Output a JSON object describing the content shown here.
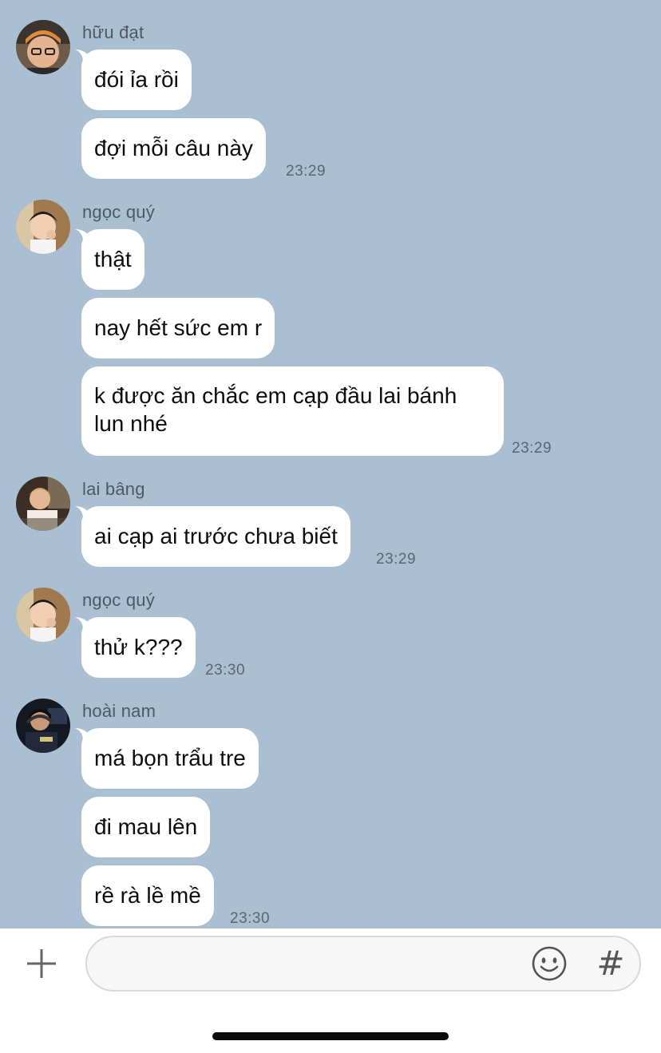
{
  "messages": [
    {
      "sender": "hữu đạt",
      "avatar": "avatar-huu-dat",
      "bubbles": [
        "đói ỉa rồi",
        "đợi mỗi câu này"
      ],
      "time": "23:29"
    },
    {
      "sender": "ngọc quý",
      "avatar": "avatar-ngoc-quy",
      "bubbles": [
        "thật",
        "nay hết sức em r",
        "k được ăn chắc em cạp đầu lai bánh lun nhé"
      ],
      "time": "23:29"
    },
    {
      "sender": "lai bâng",
      "avatar": "avatar-lai-bang",
      "bubbles": [
        "ai cạp ai trước chưa biết"
      ],
      "time": "23:29"
    },
    {
      "sender": "ngọc quý",
      "avatar": "avatar-ngoc-quy",
      "bubbles": [
        "thử k???"
      ],
      "time": "23:30"
    },
    {
      "sender": "hoài nam",
      "avatar": "avatar-hoai-nam",
      "bubbles": [
        "má bọn trẩu tre",
        "đi mau lên",
        "rề rà lề mề"
      ],
      "time": "23:30"
    }
  ],
  "composer": {
    "input_value": "",
    "icons": [
      "plus-icon",
      "emoji-icon",
      "hashtag-icon"
    ],
    "hashtag_label": "#"
  },
  "colors": {
    "chat_background": "#aabfd2",
    "bubble": "#ffffff",
    "timestamp": "#5b6672"
  }
}
